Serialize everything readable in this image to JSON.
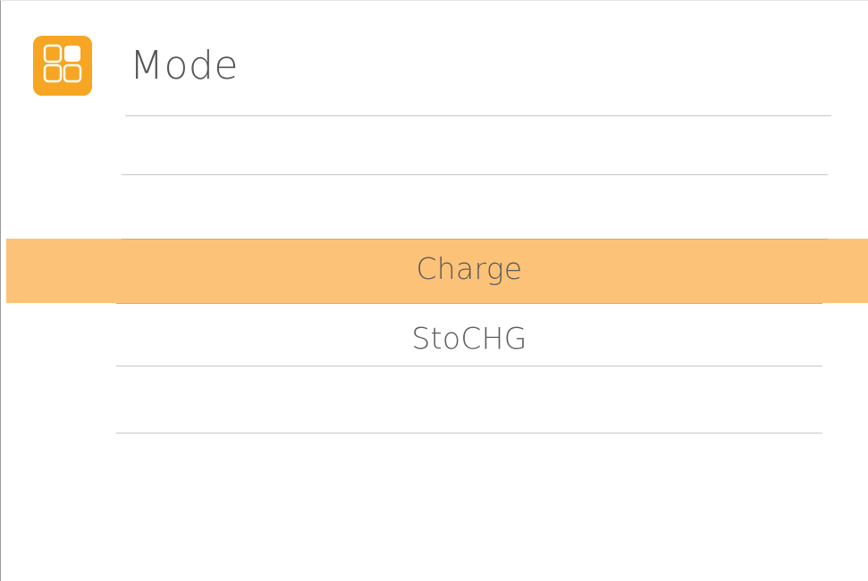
{
  "header": {
    "title": "Mode",
    "icon": "grid-apps-icon",
    "accent_color": "#f6a623"
  },
  "picker": {
    "items": [
      {
        "label": ""
      },
      {
        "label": ""
      },
      {
        "label": "Charge",
        "selected": true
      },
      {
        "label": "StoCHG"
      },
      {
        "label": ""
      }
    ],
    "selected_label": "Charge",
    "highlight_color": "#fcc278"
  }
}
